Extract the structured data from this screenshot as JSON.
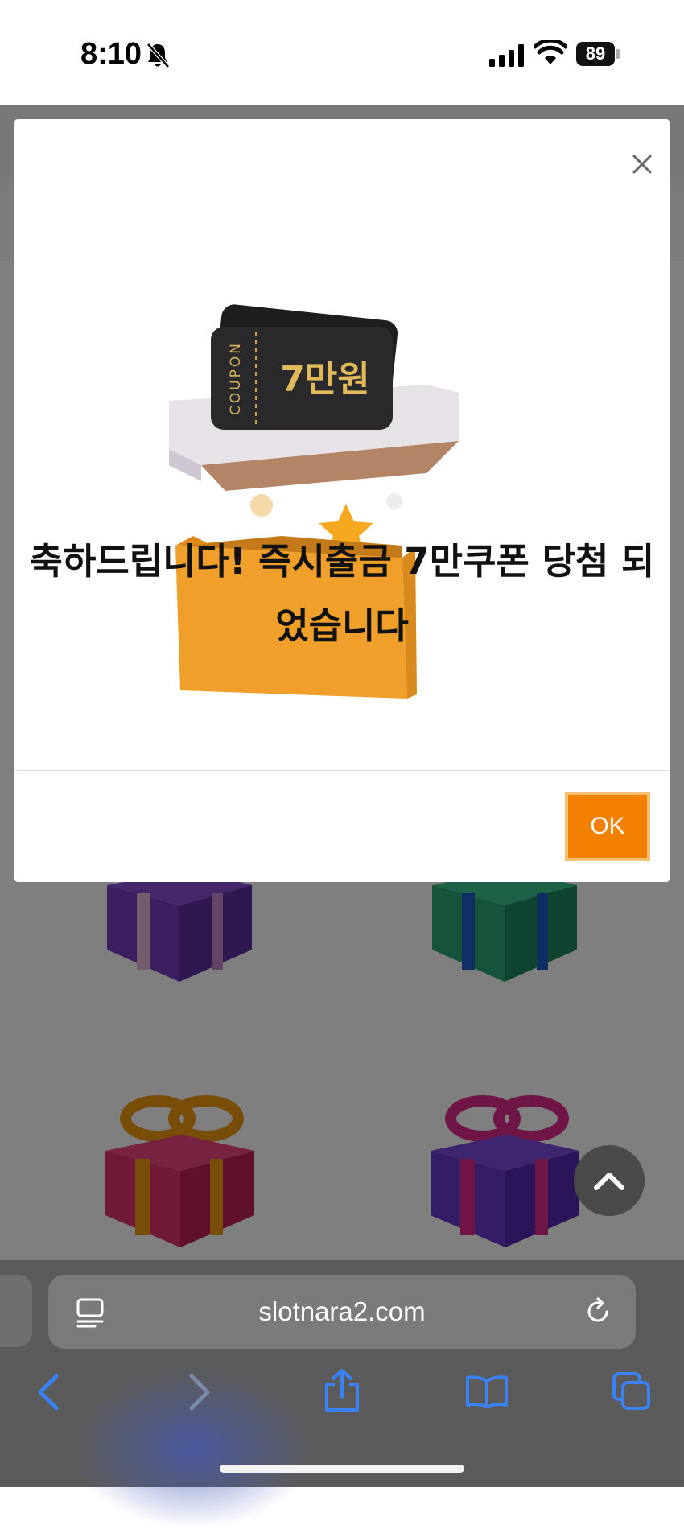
{
  "status_bar": {
    "time": "8:10",
    "battery": "89"
  },
  "modal": {
    "coupon_label": "COUPON",
    "coupon_value": "7만원",
    "message": "축하드립니다! 즉시출금 7만쿠폰 당첨 되었습니다",
    "ok_label": "OK",
    "close_icon": "close-icon"
  },
  "browser": {
    "url": "slotnara2.com"
  },
  "colors": {
    "ok_button": "#f48000",
    "browser_tint": "#4a6fd8"
  }
}
